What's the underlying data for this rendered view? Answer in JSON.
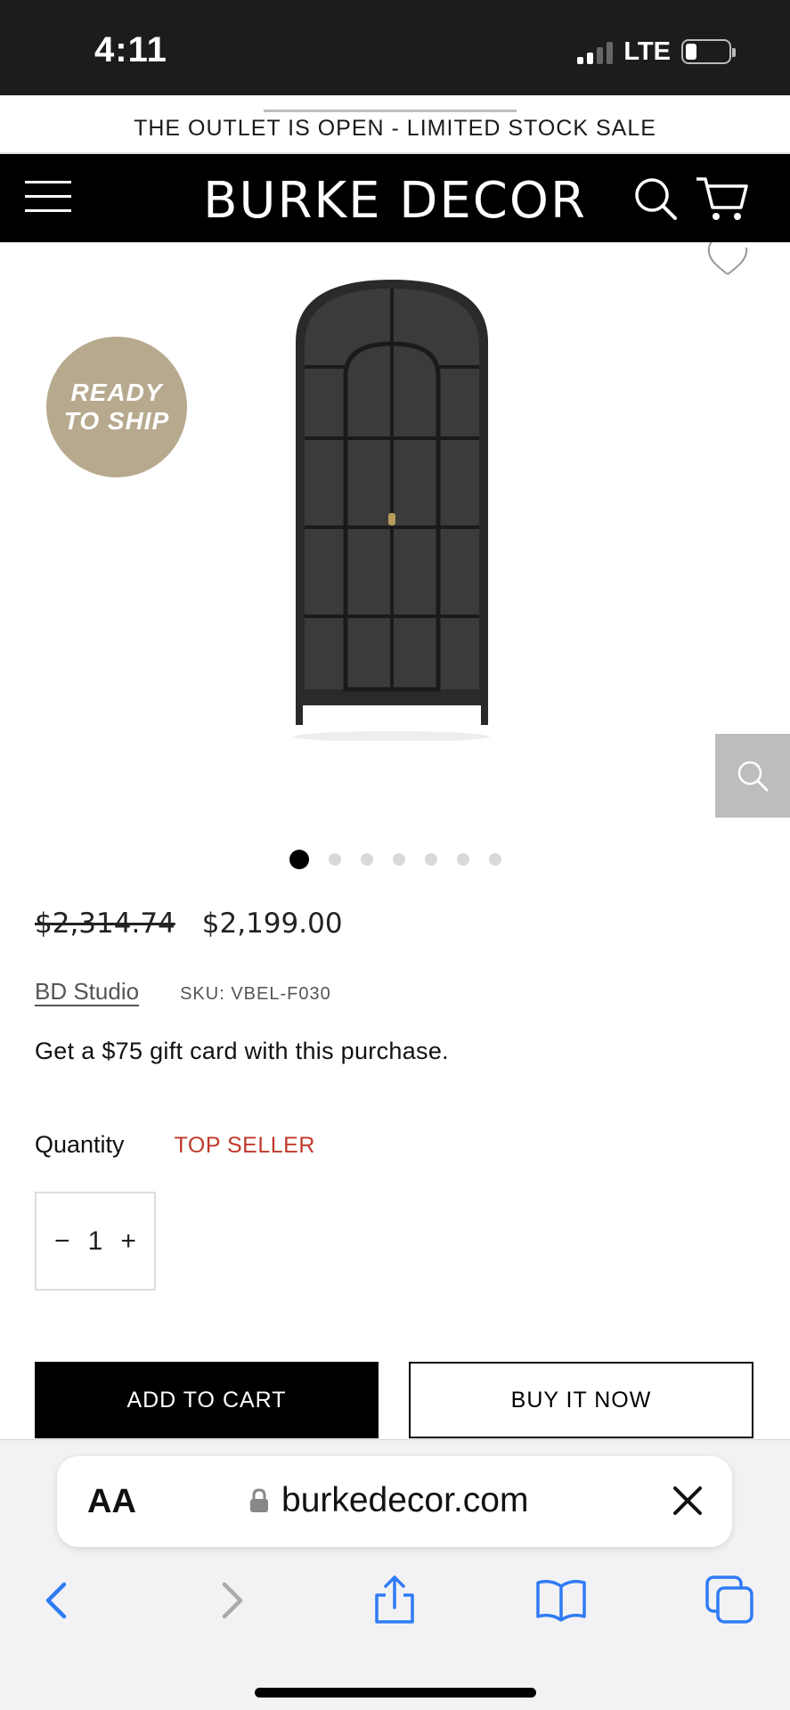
{
  "status_bar": {
    "time": "4:11",
    "network": "LTE"
  },
  "announcement": "THE OUTLET IS OPEN - LIMITED STOCK SALE",
  "header": {
    "logo": "BURKE DECOR"
  },
  "gallery": {
    "badge_line1": "READY",
    "badge_line2": "TO SHIP",
    "slide_count": 7,
    "active_slide": 1
  },
  "product": {
    "price_original": "$2,314.74",
    "price_sale": "$2,199.00",
    "vendor": "BD Studio",
    "sku": "SKU: VBEL-F030",
    "promo": "Get a $75 gift card with this purchase.",
    "quantity_label": "Quantity",
    "top_seller_label": "TOP SELLER",
    "quantity": "1",
    "minus": "−",
    "plus": "+",
    "add_to_cart": "ADD TO CART",
    "buy_now": "BUY IT NOW"
  },
  "browser": {
    "text_size_label": "AA",
    "url": "burkedecor.com"
  },
  "colors": {
    "header_bg": "#000000",
    "badge_bg": "#b7a98e",
    "top_seller": "#c0392b",
    "safari_accent": "#2f7bf5"
  },
  "icons": [
    "hamburger-icon",
    "search-icon",
    "cart-icon",
    "heart-icon",
    "zoom-icon",
    "lock-icon",
    "close-icon",
    "back-icon",
    "forward-icon",
    "share-icon",
    "bookmarks-icon",
    "tabs-icon"
  ]
}
